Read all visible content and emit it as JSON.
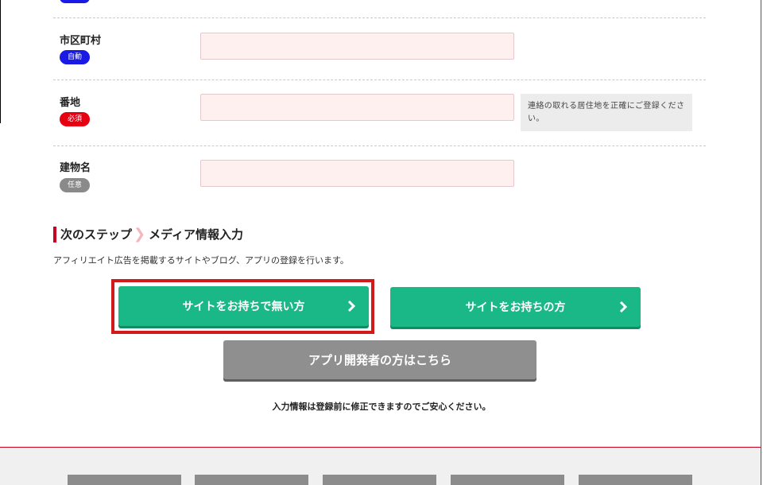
{
  "form": {
    "fields": [
      {
        "label": "市区町村",
        "badge": "自動",
        "value": ""
      },
      {
        "label": "番地",
        "badge": "必須",
        "value": "",
        "hint": "連絡の取れる居住地を正確にご登録ください。"
      },
      {
        "label": "建物名",
        "badge": "任意",
        "value": ""
      }
    ]
  },
  "next_step": {
    "title": "次のステップ",
    "target": "メディア情報入力",
    "description": "アフィリエイト広告を掲載するサイトやブログ、アプリの登録を行います。"
  },
  "buttons": {
    "no_site": "サイトをお持ちで無い方",
    "has_site": "サイトをお持ちの方",
    "app_dev": "アプリ開発者の方はこちら"
  },
  "note": "入力情報は登録前に修正できますのでご安心ください。",
  "colors": {
    "green": "#1ab886",
    "gray": "#8f8f8f",
    "brand_red": "#c6001e",
    "input_bg": "#fff0f0",
    "badge_auto": "#1a1ae6",
    "badge_required": "#e60012",
    "badge_optional": "#8a8a8a",
    "highlight": "#d11a1a"
  }
}
